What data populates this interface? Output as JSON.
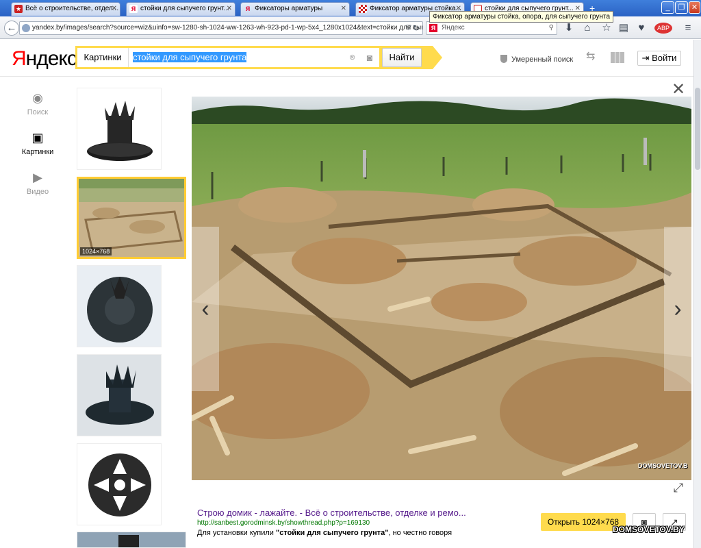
{
  "tabs": [
    {
      "label": "Всё о строительстве, отдел...",
      "icon": "red-star-icon",
      "color": "#cc2222"
    },
    {
      "label": "стойки для сыпучего грунт...",
      "icon": "yandex-y-icon",
      "color": "#e4002b"
    },
    {
      "label": "Фиксаторы арматуры",
      "icon": "yandex-y-icon",
      "color": "#e4002b"
    },
    {
      "label": "Фиксатор арматуры стойка...",
      "icon": "checker-icon",
      "color": "#cc2222"
    },
    {
      "label": "стойки для сыпучего грунт...",
      "icon": "page-icon",
      "color": "#cc2222"
    }
  ],
  "tooltip": "Фиксатор арматуры стойка, опора, для сыпучего грунта",
  "browser": {
    "url": "yandex.by/images/search?source=wiz&uinfo=sw-1280-sh-1024-ww-1263-wh-923-pd-1-wp-5x4_1280x1024&text=стойки для сыпучего гр",
    "search_placeholder": "Яндекс",
    "new_tab": "+"
  },
  "header": {
    "logo_first": "Я",
    "logo_rest": "ндекс",
    "service": "Картинки",
    "query": "стойки для сыпучего грунта",
    "find_button": "Найти",
    "safe_search": "Умеренный поиск",
    "login": "Войти"
  },
  "left_nav": [
    {
      "label": "Поиск",
      "icon": "search-circle-icon"
    },
    {
      "label": "Картинки",
      "icon": "image-icon"
    },
    {
      "label": "Видео",
      "icon": "video-play-icon"
    }
  ],
  "thumbnails": [
    {
      "kind": "spacer-stand"
    },
    {
      "kind": "foundation-photo",
      "badge": "1024×768"
    },
    {
      "kind": "spacer-disc"
    },
    {
      "kind": "spacer-stand-2"
    },
    {
      "kind": "spacer-wheel"
    },
    {
      "kind": "partial"
    }
  ],
  "viewer": {
    "photo_watermark": "DOMSOVETOV.B",
    "caption_title": "Строю домик - лажайте. - Всё о строительстве, отделке и ремо...",
    "caption_url": "http://sanbest.gorodminsk.by/showthread.php?p=169130",
    "caption_text_prefix": "Для установки купили ",
    "caption_text_bold": "\"стойки для сыпучего грунта\"",
    "caption_text_suffix": ", но честно говоря",
    "open_button": "Открыть 1024×768"
  },
  "watermark": "DOMSOVETOV.BY",
  "colors": {
    "accent": "#ffdb4d",
    "link": "#551a8b",
    "url": "#007700"
  }
}
